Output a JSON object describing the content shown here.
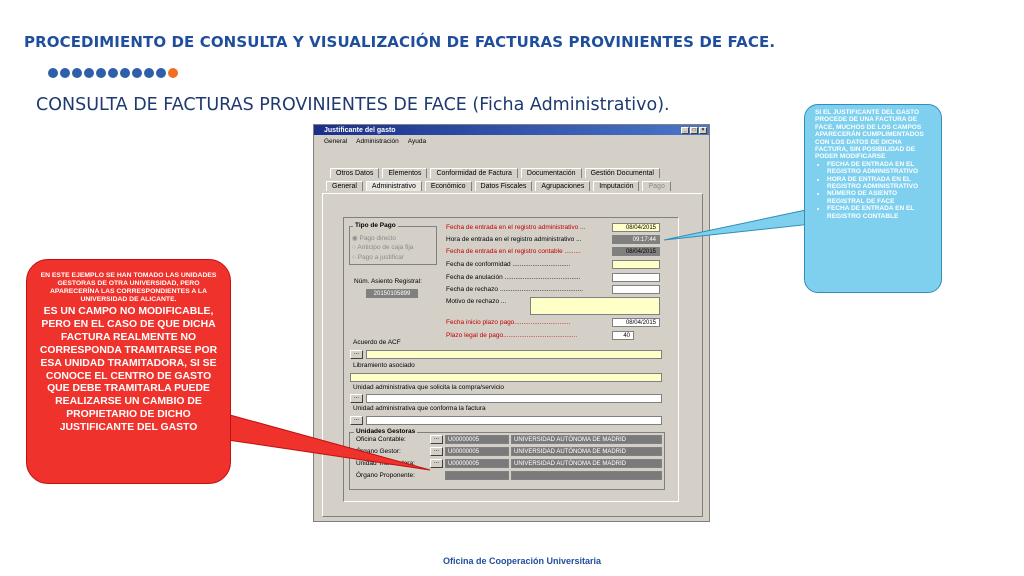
{
  "slide": {
    "title": "PROCEDIMIENTO DE CONSULTA Y VISUALIZACIÓN DE FACTURAS PROVINIENTES DE FACE.",
    "subtitle": "CONSULTA DE FACTURAS PROVINIENTES DE FACE (Ficha Administrativo).",
    "footer": "Oficina de Cooperación Universitaria",
    "colors": {
      "title": "#1f4e9c",
      "dots": "#2e5fa8",
      "dot_accent": "#f26f21",
      "left_callout": "#f0322d",
      "right_callout": "#7fd0ee"
    }
  },
  "window": {
    "title": "Justificante del gasto",
    "menu": [
      "General",
      "Administración",
      "Ayuda"
    ],
    "tabs_top": [
      "Otros Datos",
      "Elementos",
      "Conformidad de Factura",
      "Documentación",
      "Gestión Documental"
    ],
    "tabs_bottom": [
      "General",
      "Administrativo",
      "Económico",
      "Datos Fiscales",
      "Agrupaciones",
      "Imputación",
      "Pago"
    ],
    "tipo_pago": {
      "title": "Tipo de Pago",
      "options": [
        "Pago directo",
        "Anticipo de caja fija",
        "Pago a justificar"
      ]
    },
    "asiento": {
      "label": "Núm. Asiento Registral:",
      "value": "20150105899"
    },
    "fields": {
      "entrada_admin": {
        "label": "Fecha de entrada en el registro administrativo ...",
        "value": "08/04/2015"
      },
      "hora_admin": {
        "label": "Hora de entrada en el registro administrativo ...",
        "value": "09:17:44"
      },
      "entrada_contable": {
        "label": "Fecha de entrada en el registro contable .........",
        "value": "08/04/2015"
      },
      "conformidad": {
        "label": "Fecha de conformidad ................................",
        "value": ""
      },
      "anulacion": {
        "label": "Fecha de anulación ..........................................",
        "value": ""
      },
      "rechazo": {
        "label": "Fecha de rechazo ..............................................",
        "value": ""
      },
      "motivo_rechazo": {
        "label": "Motivo de rechazo ...",
        "value": ""
      },
      "inicio_plazo": {
        "label": "Fecha inicio plazo pago...............................",
        "value": "08/04/2015"
      },
      "plazo_legal": {
        "label": "Plazo legal de pago.........................................",
        "value": "40"
      }
    },
    "acuerdo_acf": "Acuerdo de ACF",
    "libramiento": "Libramiento asociado",
    "unidad_solicita": "Unidad administrativa que solicita la compra/servicio",
    "unidad_conforma": "Unidad administrativa que conforma la factura",
    "unidades_gestoras": {
      "title": "Unidades Gestoras",
      "rows": [
        {
          "label": "Oficina Contable:",
          "code": "U00000005",
          "name": "UNIVERSIDAD AUTÓNOMA DE MADRID"
        },
        {
          "label": "Órgano Gestor:",
          "code": "U00000005",
          "name": "UNIVERSIDAD AUTÓNOMA DE MADRID"
        },
        {
          "label": "Unidad Tramitadora:",
          "code": "U00000005",
          "name": "UNIVERSIDAD AUTÓNOMA DE MADRID"
        },
        {
          "label": "Órgano Proponente:",
          "code": "",
          "name": ""
        }
      ]
    }
  },
  "callout_left": {
    "small": "EN ESTE EJEMPLO SE HAN TOMADO LAS UNIDADES GESTORAS DE OTRA UNIVERSIDAD, PERO APARECERÍNA LAS CORRESPONDIENTES A LA UNIVERSIDAD DE ALICANTE.",
    "big": "ES UN CAMPO NO MODIFICABLE, PERO EN EL CASO DE QUE DICHA FACTURA REALMENTE NO CORRESPONDA TRAMITARSE POR ESA UNIDAD TRAMITADORA, SI SE CONOCE EL CENTRO DE GASTO QUE DEBE TRAMITARLA PUEDE REALIZARSE UN CAMBIO DE PROPIETARIO DE DICHO JUSTIFICANTE DEL GASTO"
  },
  "callout_right": {
    "intro": "SI EL JUSTIFICANTE DEL GASTO PROCEDE DE UNA FACTURA DE FACE, MUCHOS DE LOS CAMPOS APARECERÁN CUMPLIMENTADOS CON LOS DATOS DE DICHA FACTURA, SIN POSIBILIDAD DE PODER MODIFICARSE",
    "items": [
      "FECHA DE ENTRADA EN EL REGISTRO ADMINISTRATIVO",
      "HORA DE ENTRADA EN EL REGISTRO ADMINISTRATIVO",
      "NÚMERO DE ASIENTO REGISTRAL DE FACE",
      "FECHA DE ENTRADA EN EL REGISTRO CONTABLE"
    ]
  }
}
